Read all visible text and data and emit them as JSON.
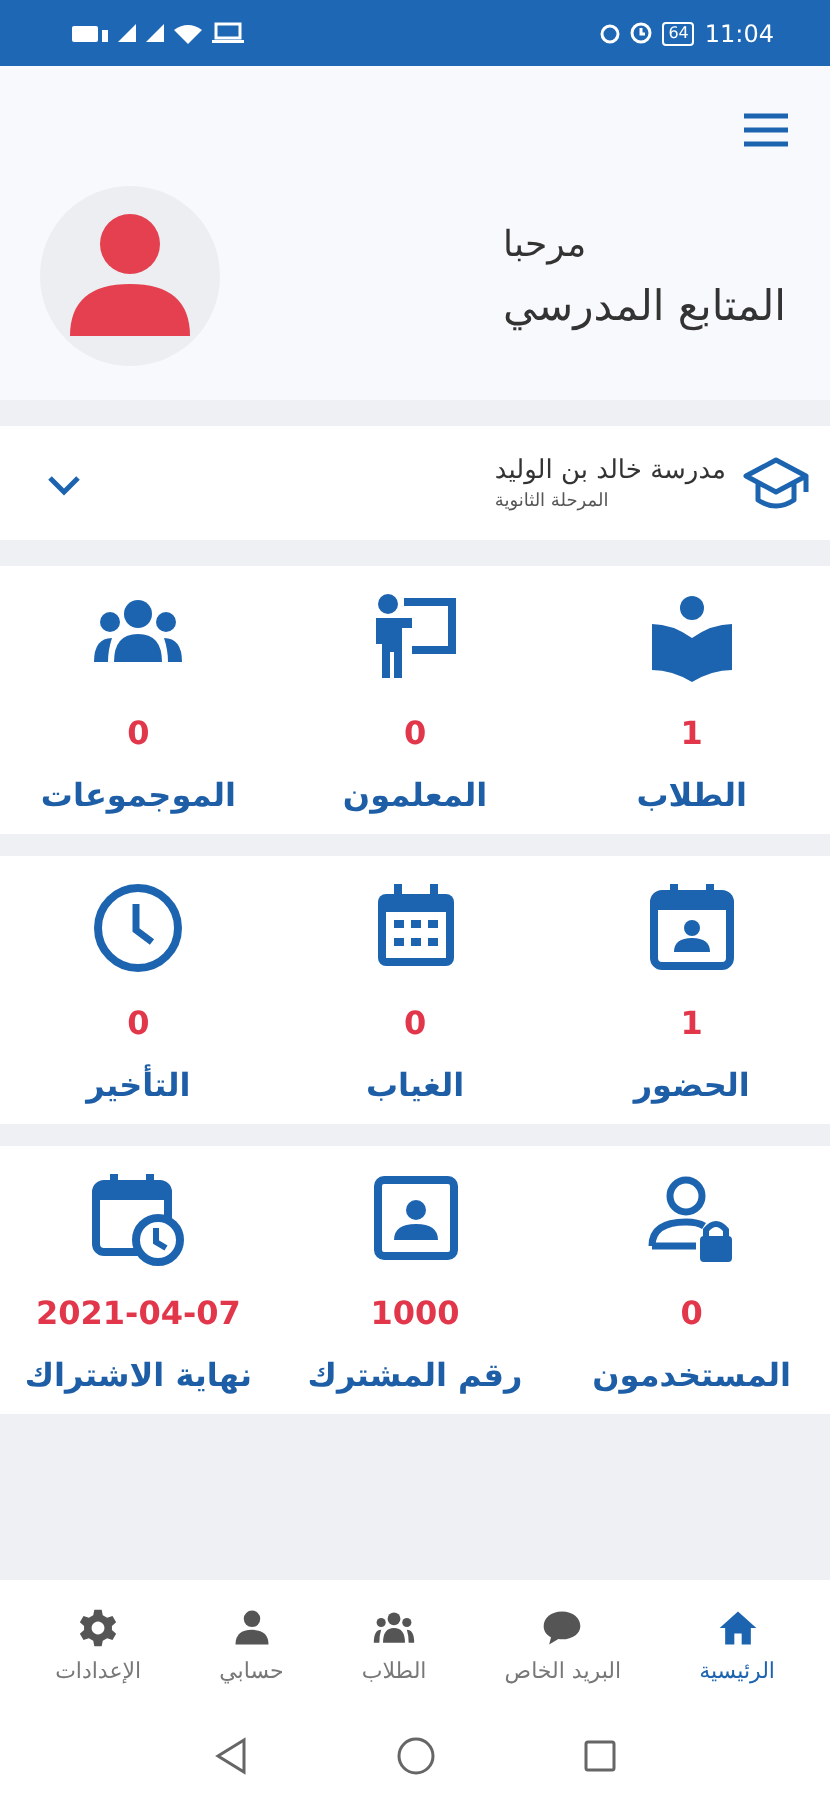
{
  "status_bar": {
    "battery": "64",
    "time": "11:04"
  },
  "header": {
    "greeting": "مرحبا",
    "role": "المتابع المدرسي"
  },
  "school": {
    "name": "مدرسة خالد بن الوليد",
    "stage": "المرحلة الثانوية"
  },
  "stat_groups": [
    {
      "tiles": [
        {
          "value": "1",
          "label": "الطلاب"
        },
        {
          "value": "0",
          "label": "المعلمون"
        },
        {
          "value": "0",
          "label": "الموجموعات"
        }
      ]
    },
    {
      "tiles": [
        {
          "value": "1",
          "label": "الحضور"
        },
        {
          "value": "0",
          "label": "الغياب"
        },
        {
          "value": "0",
          "label": "التأخير"
        }
      ]
    },
    {
      "tiles": [
        {
          "value": "0",
          "label": "المستخدمون"
        },
        {
          "value": "1000",
          "label": "رقم المشترك"
        },
        {
          "value": "2021-04-07",
          "label": "نهاية الاشتراك"
        }
      ]
    }
  ],
  "bottom_nav": [
    {
      "label": "الرئيسية",
      "selected": true
    },
    {
      "label": "البريد الخاص",
      "selected": false
    },
    {
      "label": "الطلاب",
      "selected": false
    },
    {
      "label": "حسابي",
      "selected": false
    },
    {
      "label": "الإعدادات",
      "selected": false
    }
  ]
}
